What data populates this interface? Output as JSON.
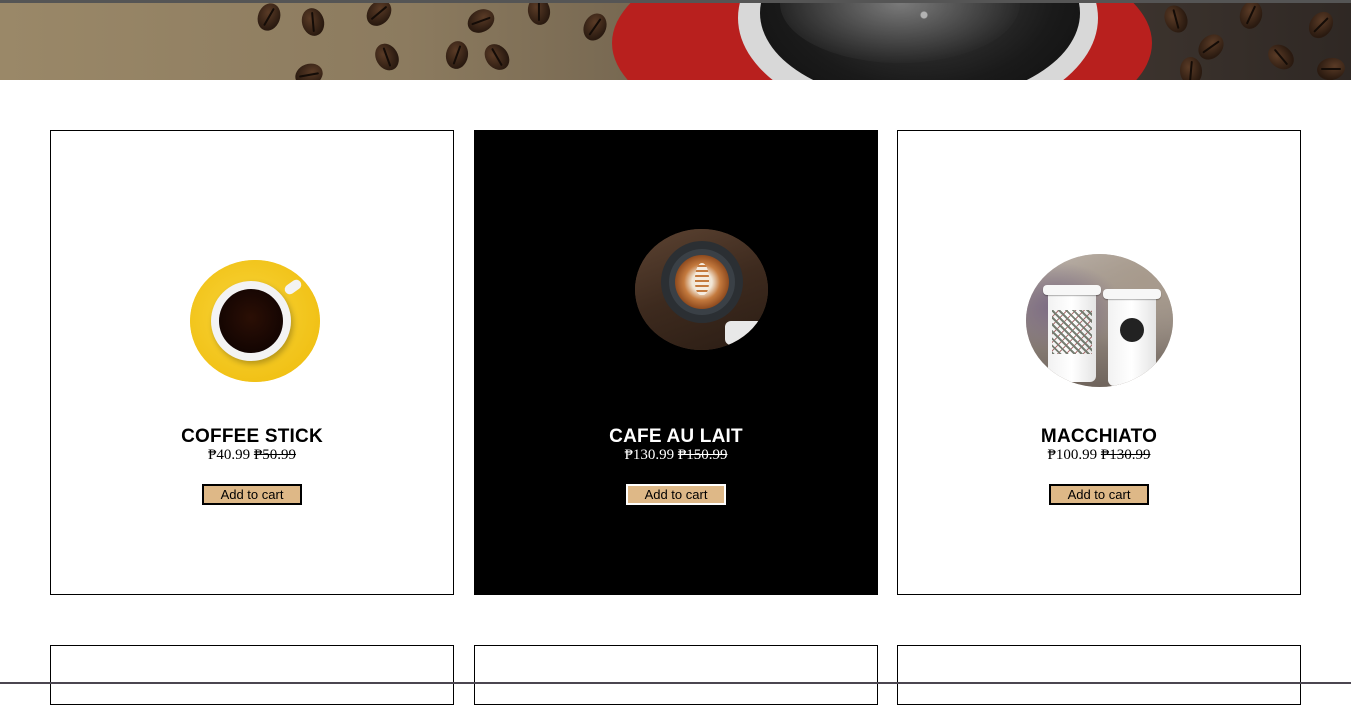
{
  "hero": {
    "description_icon": "coffee-beans-banner"
  },
  "products": [
    {
      "name": "COFFEE STICK",
      "price": "₱40.99",
      "old_price": "₱50.99",
      "button_label": "Add to cart",
      "image_icon": "coffee-cup-yellow-saucer",
      "theme": "light"
    },
    {
      "name": "CAFE AU LAIT",
      "price": "₱130.99",
      "old_price": "₱150.99",
      "button_label": "Add to cart",
      "image_icon": "latte-art-cup",
      "theme": "dark"
    },
    {
      "name": "MACCHIATO",
      "price": "₱100.99",
      "old_price": "₱130.99",
      "button_label": "Add to cart",
      "image_icon": "paper-coffee-cups",
      "theme": "light"
    }
  ],
  "colors": {
    "button_bg": "#deb887",
    "dark_card_bg": "#000000",
    "light_card_bg": "#ffffff"
  }
}
